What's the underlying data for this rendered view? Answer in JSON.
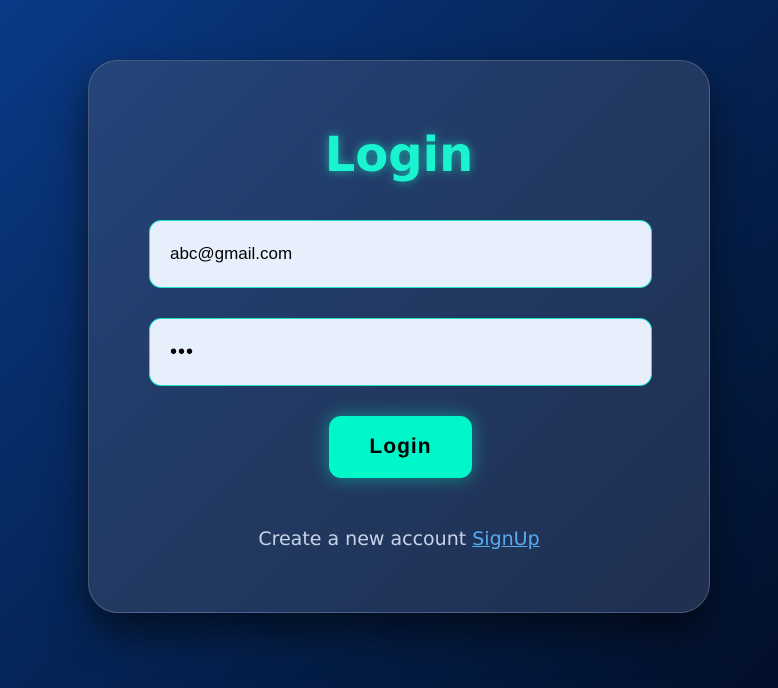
{
  "login_form": {
    "title": "Login",
    "email_value": "abc@gmail.com",
    "password_value": "•••",
    "submit_label": "Login",
    "signup_prompt": "Create a new account",
    "signup_link": "SignUp"
  },
  "colors": {
    "accent": "#00f7c9",
    "title": "#19f3cf",
    "link": "#5aaaf0",
    "input_bg": "#e8effc"
  }
}
